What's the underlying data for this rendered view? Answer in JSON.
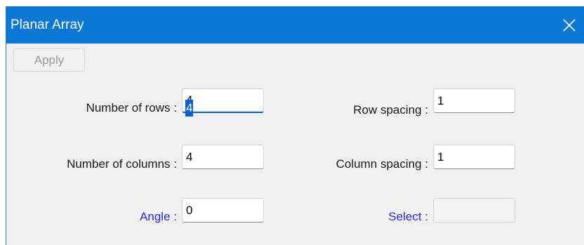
{
  "window": {
    "title": "Planar Array",
    "close_icon": "close-icon"
  },
  "toolbar": {
    "apply_label": "Apply"
  },
  "form": {
    "rows_label": "Number of rows :",
    "rows_value": "4",
    "columns_label": "Number of columns :",
    "columns_value": "4",
    "angle_label": "Angle :",
    "angle_value": "0",
    "row_spacing_label": "Row spacing :",
    "row_spacing_value": "1",
    "column_spacing_label": "Column spacing :",
    "column_spacing_value": "1",
    "select_label": "Select :",
    "select_value": ""
  },
  "colors": {
    "titlebar": "#0a78d4",
    "link_label": "#2b2bd6",
    "selection": "#0a60d0"
  }
}
